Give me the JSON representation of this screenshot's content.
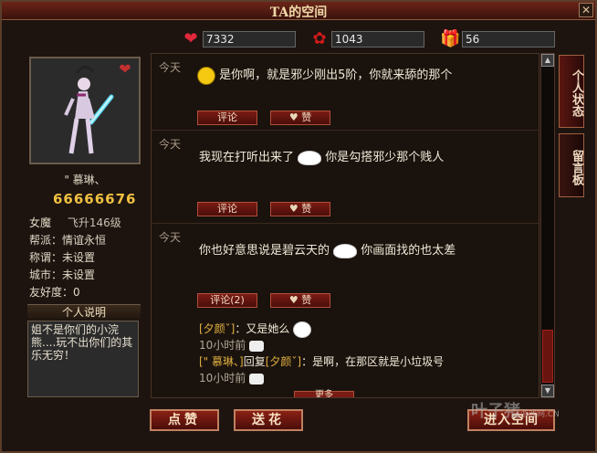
{
  "window": {
    "title": "TA的空间",
    "close_label": "✕"
  },
  "stats": {
    "hearts": "7332",
    "roses": "1043",
    "gifts": "56"
  },
  "profile": {
    "name": "\" 慕琳、",
    "id_number": "66666676",
    "class_label": "女魔",
    "level": "飞升146级",
    "guild": "帮派：情谊永恒",
    "title": "称谓：未设置",
    "city": "城市：未设置",
    "friendliness": "友好度：0",
    "section_title": "个人说明",
    "description": "姐不是你们的小浣熊....玩不出你们的其乐无穷！"
  },
  "posts": [
    {
      "time": "今天",
      "text": "是你啊，就是邪少刚出5阶，你就来舔的那个",
      "comment_label": "评论",
      "like_label": "赞"
    },
    {
      "time": "今天",
      "text_before": "我现在打听出来了",
      "text_after": "你是勾搭邪少那个贱人",
      "comment_label": "评论",
      "like_label": "赞"
    },
    {
      "time": "今天",
      "text_before": "你也好意思说是碧云天的",
      "text_after": "你画面找的也太差",
      "comment_label": "评论(2)",
      "like_label": "赞"
    }
  ],
  "replies": [
    {
      "user": "[夕颜ˇ]",
      "text": "：又是她么",
      "time": "10小时前"
    },
    {
      "user": "[\" 慕琳、]",
      "verb": "回复",
      "target": "[夕颜ˇ]",
      "text": "：是啊，在那区就是小垃圾号",
      "time": "10小时前"
    }
  ],
  "more_label": "更多",
  "side_tabs": [
    "个人状态",
    "留言板"
  ],
  "bottom_buttons": {
    "like": "点赞",
    "flower": "送花",
    "home": "进入空间"
  },
  "watermark": {
    "main": "叶子猪",
    "sub": "游戏网",
    "domain": ".CN"
  }
}
